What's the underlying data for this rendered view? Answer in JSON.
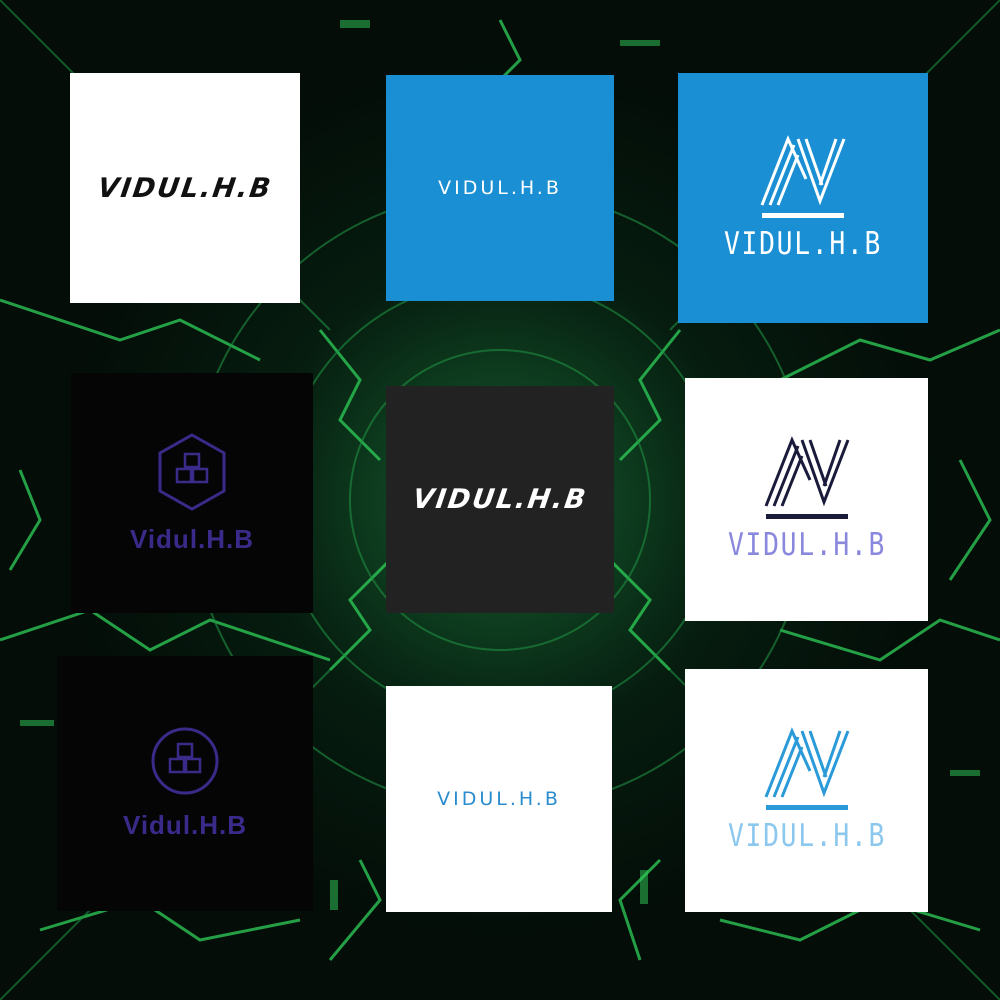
{
  "logos": [
    {
      "text": "VIDUL.H.B",
      "style": "script",
      "background": "#ffffff",
      "text_color": "#111111"
    },
    {
      "text": "VIDUL.H.B",
      "style": "wide",
      "background": "#1a8fd3",
      "text_color": "#ffffff"
    },
    {
      "text": "VIDUL.H.B",
      "style": "av-monogram",
      "icon": "av-monogram-icon",
      "background": "#1a8fd3",
      "text_color": "#ffffff"
    },
    {
      "text": "Vidul.H.B",
      "style": "hexagon-badge",
      "icon": "cubes-hexagon-icon",
      "background": "#050505",
      "text_color": "#3a2a8a"
    },
    {
      "text": "VIDUL.H.B",
      "style": "script",
      "background": "#222222",
      "text_color": "#ffffff"
    },
    {
      "text": "VIDUL.H.B",
      "style": "av-monogram",
      "icon": "av-monogram-icon",
      "background": "#ffffff",
      "text_color": "#8a88dc",
      "icon_color": "#1a1a3a"
    },
    {
      "text": "Vidul.H.B",
      "style": "circle-badge",
      "icon": "cubes-circle-icon",
      "background": "#050505",
      "text_color": "#3a2a8a"
    },
    {
      "text": "VIDUL.H.B",
      "style": "wide",
      "background": "#ffffff",
      "text_color": "#2a8ccf"
    },
    {
      "text": "VIDUL.H.B",
      "style": "av-monogram",
      "icon": "av-monogram-icon",
      "background": "#ffffff",
      "text_color": "#8cc8ee",
      "icon_color": "#2a9ad8"
    }
  ],
  "colors": {
    "background_green": "#2fd05a",
    "background_dark": "#040d08"
  }
}
